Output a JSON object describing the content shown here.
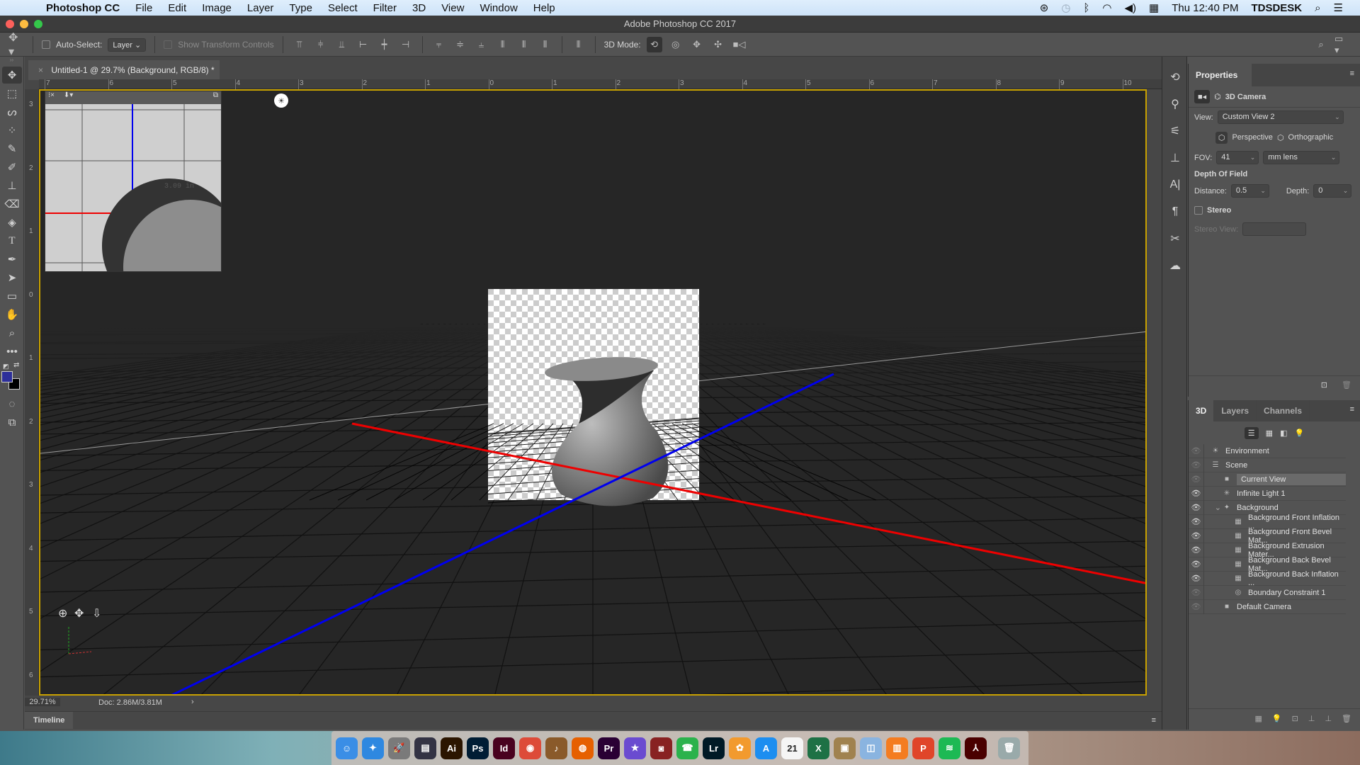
{
  "menubar": {
    "app_name": "Photoshop CC",
    "items": [
      "File",
      "Edit",
      "Image",
      "Layer",
      "Type",
      "Select",
      "Filter",
      "3D",
      "View",
      "Window",
      "Help"
    ],
    "clock": "Thu 12:40 PM",
    "user": "TDSDESK"
  },
  "window": {
    "title": "Adobe Photoshop CC 2017"
  },
  "options_bar": {
    "auto_select_label": "Auto-Select:",
    "auto_select_checked": false,
    "auto_select_target": "Layer",
    "show_transform_label": "Show Transform Controls",
    "mode_label": "3D Mode:"
  },
  "document": {
    "tab_title": "Untitled-1 @ 29.7% (Background, RGB/8) *",
    "zoom": "29.71%",
    "doc_size": "Doc: 2.86M/3.81M",
    "hruler_labels": [
      "7",
      "6",
      "5",
      "4",
      "3",
      "2",
      "1",
      "0",
      "1",
      "2",
      "3",
      "4",
      "5",
      "6",
      "7",
      "8",
      "9",
      "10"
    ],
    "vruler_labels": [
      "3",
      "2",
      "1",
      "0",
      "1",
      "2",
      "3",
      "4",
      "5",
      "6"
    ],
    "secondary_view_measure": "3.09 in",
    "foreground_color": "#2d2f9a",
    "background_color": "#000000"
  },
  "timeline": {
    "label": "Timeline"
  },
  "properties": {
    "tab": "Properties",
    "section": "3D Camera",
    "view_label": "View:",
    "view_value": "Custom View 2",
    "perspective_label": "Perspective",
    "orthographic_label": "Orthographic",
    "fov_label": "FOV:",
    "fov_value": "41",
    "lens_value": "mm lens",
    "dof_label": "Depth Of Field",
    "distance_label": "Distance:",
    "distance_value": "0.5",
    "depth_label": "Depth:",
    "depth_value": "0",
    "stereo_label": "Stereo",
    "stereo_view_label": "Stereo View:"
  },
  "panel3d": {
    "tabs": [
      "3D",
      "Layers",
      "Channels"
    ],
    "items": [
      {
        "name": "Environment",
        "indent": 0,
        "icon": "☀",
        "visible": false
      },
      {
        "name": "Scene",
        "indent": 0,
        "icon": "☰",
        "visible": false
      },
      {
        "name": "Current View",
        "indent": 1,
        "icon": "■",
        "visible": false,
        "selected": true
      },
      {
        "name": "Infinite Light 1",
        "indent": 1,
        "icon": "✳",
        "visible": true
      },
      {
        "name": "Background",
        "indent": 1,
        "icon": "✦",
        "visible": true,
        "expanded": true
      },
      {
        "name": "Background Front Inflation ...",
        "indent": 2,
        "icon": "▦",
        "visible": true
      },
      {
        "name": "Background Front Bevel Mat...",
        "indent": 2,
        "icon": "▦",
        "visible": true
      },
      {
        "name": "Background Extrusion Mater...",
        "indent": 2,
        "icon": "▦",
        "visible": true
      },
      {
        "name": "Background Back Bevel Mat...",
        "indent": 2,
        "icon": "▦",
        "visible": true
      },
      {
        "name": "Background Back Inflation ...",
        "indent": 2,
        "icon": "▦",
        "visible": true
      },
      {
        "name": "Boundary Constraint 1",
        "indent": 2,
        "icon": "◎",
        "visible": false
      },
      {
        "name": "Default Camera",
        "indent": 1,
        "icon": "■",
        "visible": false
      }
    ]
  },
  "dock": {
    "apps": [
      {
        "label": "Finder",
        "glyph": "☺",
        "color": "#3a8ee6"
      },
      {
        "label": "Safari",
        "glyph": "✦",
        "color": "#2e88e0"
      },
      {
        "label": "Launchpad",
        "glyph": "🚀",
        "color": "#7a7a7a"
      },
      {
        "label": "Mission Control",
        "glyph": "▤",
        "color": "#334"
      },
      {
        "label": "Illustrator",
        "glyph": "Ai",
        "color": "#2b1500"
      },
      {
        "label": "Photoshop",
        "glyph": "Ps",
        "color": "#001d34"
      },
      {
        "label": "InDesign",
        "glyph": "Id",
        "color": "#49021f"
      },
      {
        "label": "Chrome",
        "glyph": "◉",
        "color": "#dd4b39"
      },
      {
        "label": "GarageBand",
        "glyph": "♪",
        "color": "#8a5a2a"
      },
      {
        "label": "Firefox",
        "glyph": "◍",
        "color": "#e66000"
      },
      {
        "label": "Premiere Pro",
        "glyph": "Pr",
        "color": "#2a0034"
      },
      {
        "label": "iMovie",
        "glyph": "★",
        "color": "#6a4bd0"
      },
      {
        "label": "Photo Booth",
        "glyph": "◙",
        "color": "#822"
      },
      {
        "label": "FaceTime",
        "glyph": "☎",
        "color": "#2bb24c"
      },
      {
        "label": "Lightroom",
        "glyph": "Lr",
        "color": "#001a26"
      },
      {
        "label": "Photos",
        "glyph": "✿",
        "color": "#f29a2e"
      },
      {
        "label": "App Store",
        "glyph": "A",
        "color": "#1c8ef0"
      },
      {
        "label": "Calendar",
        "glyph": "21",
        "color": "#f5f5f5"
      },
      {
        "label": "Excel",
        "glyph": "X",
        "color": "#1e7145"
      },
      {
        "label": "Notefile",
        "glyph": "▣",
        "color": "#a0824f"
      },
      {
        "label": "Preview",
        "glyph": "◫",
        "color": "#8ab4e0"
      },
      {
        "label": "iBooks",
        "glyph": "▥",
        "color": "#f47c20"
      },
      {
        "label": "Pages",
        "glyph": "P",
        "color": "#e0452a"
      },
      {
        "label": "Spotify",
        "glyph": "≋",
        "color": "#1db954"
      },
      {
        "label": "Acrobat",
        "glyph": "⅄",
        "color": "#4a0000"
      },
      {
        "label": "Trash",
        "glyph": "🗑",
        "color": "#9aa"
      }
    ]
  }
}
